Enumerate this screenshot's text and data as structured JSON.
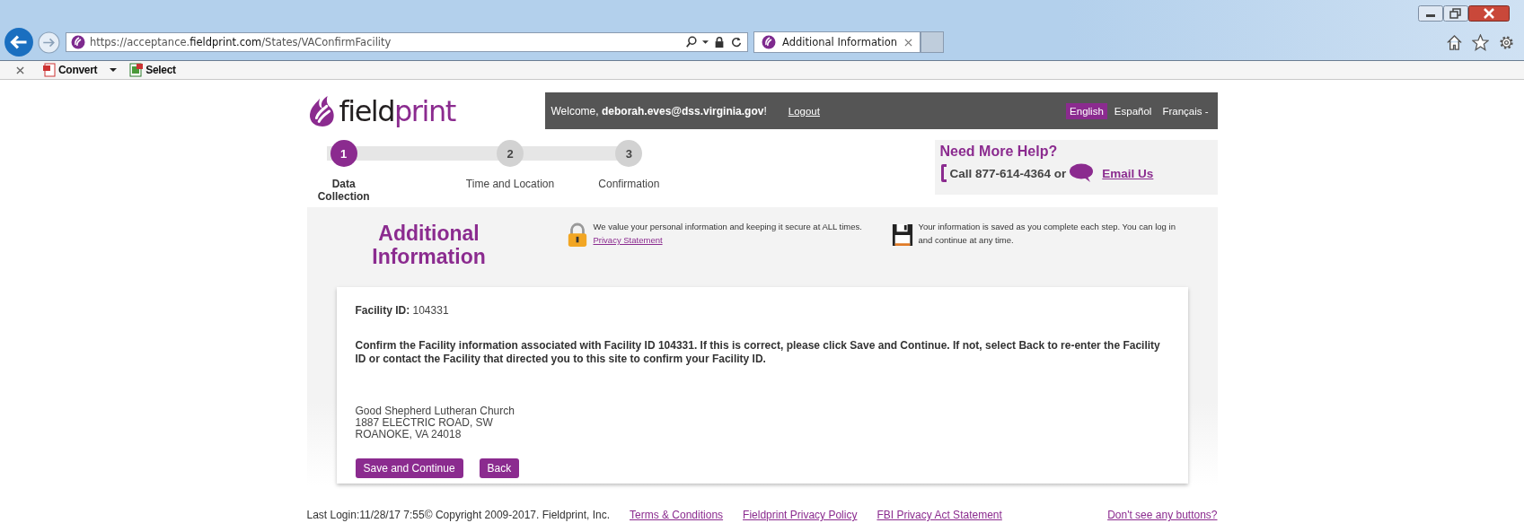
{
  "browser": {
    "url_prefix": "https://acceptance.",
    "url_domain": "fieldprint.com",
    "url_path": "/States/VAConfirmFacility",
    "tabs": [
      {
        "title": "Additional Information",
        "selected": true
      }
    ],
    "toolbar": [
      {
        "label": "Convert",
        "kind": "dropdown"
      },
      {
        "label": "Select",
        "kind": "plain"
      }
    ]
  },
  "header": {
    "logo_dark": "field",
    "logo_accent": "print",
    "welcome": "Welcome, **deborah.eves@dss.virginia.gov**!",
    "logout": "Logout",
    "languages": [
      {
        "label": "English",
        "selected": true
      },
      {
        "label": "Español",
        "selected": false
      },
      {
        "label": "Français -",
        "selected": false
      }
    ]
  },
  "steps": [
    {
      "number": "1",
      "label": "Data Collection",
      "selected": true
    },
    {
      "number": "2",
      "label": "Time and Location",
      "selected": false
    },
    {
      "number": "3",
      "label": "Confirmation",
      "selected": false
    }
  ],
  "help": {
    "title": "Need More Help?",
    "phone": "Call 877-614-4364 or",
    "email": "Email Us"
  },
  "title": "Additional Information",
  "notices": [
    {
      "kind": "lock",
      "text": "We value your personal information and keeping it secure at ALL times.",
      "link": "Privacy Statement"
    },
    {
      "kind": "disk",
      "text": "Your information is saved as you complete each step. You can log in and continue at any time."
    }
  ],
  "card": {
    "facility_label": "Facility ID:",
    "facility_id": "104331",
    "message": "Confirm the Facility information associated with Facility ID 104331. If this is correct, please click Save and Continue. If not, select Back to re-enter the Facility ID or contact the Facility that directed you to this site to confirm your Facility ID.",
    "address": [
      "Good Shepherd Lutheran Church",
      "1887 ELECTRIC ROAD, SW",
      "ROANOKE, VA 24018"
    ],
    "buttons": [
      "Save and Continue",
      "Back"
    ]
  },
  "footer": {
    "text": "Last Login:11/28/17 7:55© Copyright 2009-2017. Fieldprint, Inc.",
    "links": [
      "Terms & Conditions",
      "Fieldprint Privacy Policy",
      "FBI Privacy Act Statement"
    ],
    "help_link": "Don't see any buttons?"
  }
}
